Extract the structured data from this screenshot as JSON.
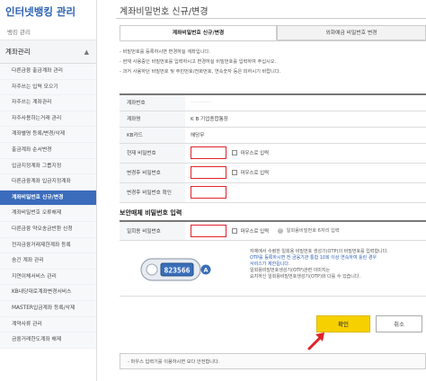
{
  "sidebar": {
    "title": "인터넷뱅킹 관리",
    "subtitle": "뱅킹 관리",
    "section": "계좌관리",
    "items": [
      "다른금융 출금계좌 관리",
      "자주쓰는 입력 모으기",
      "자주쓰는 계좌관리",
      "자주사용하는거래 관리",
      "계좌별명 등록/변경/삭제",
      "출금계좌 순서변경",
      "입금지정계좌 그룹지정",
      "다른금융계좌 입금지정계좌",
      "계좌비밀번호 신규/변경",
      "계좌비밀번호 오류해제",
      "다른금융 약오송금반환 신청",
      "전자금융거래제한계좌 등록",
      "숨긴 계좌 관리",
      "지연이체서비스 관리",
      "KB내당대로계좌변경서비스",
      "MASTER입금계좌 등록/삭제",
      "계약사류 관리",
      "금융거래한도계좌 해제"
    ],
    "active_index": 8
  },
  "page": {
    "title": "계좌비밀번호 신규/변경",
    "tabs": [
      "계좌비밀번호 신규/변경",
      "외화예금 비밀번호 변경"
    ],
    "notices": [
      "- 비밀번호를 등록하시면 변경하실 계좌입니다.",
      "- 현재 사용중인 비밀번호를 입력하시고 변경하실 비밀번호를 입력하여 주십시오.",
      "- 과거 사용하던 비밀번호 및 주민번호/전화번호, 연속숫자 등은 피하시기 바랍니다."
    ]
  },
  "form": {
    "rows": [
      {
        "label": "계좌번호",
        "value": "·············"
      },
      {
        "label": "계좌명",
        "value": "K B 기업종합통장"
      },
      {
        "label": "KB카드",
        "value": "해당무"
      },
      {
        "label": "현재 비밀번호",
        "value": ""
      },
      {
        "label": "변경후 비밀번호",
        "value": ""
      },
      {
        "label": "변경후 비밀번호 확인",
        "value": ""
      }
    ],
    "mouse_input_label": "마우스로 입력"
  },
  "security": {
    "title": "보안매체 비밀번호 입력",
    "otp_label": "일회용 비밀번호",
    "mouse_input_label": "마우스로 입력",
    "help_label": "일회용비밀번호 6자리 입력",
    "device_display": "823566",
    "device_marker": "A",
    "notes": [
      {
        "text": "자체에서 수령한 일회용 비밀번호 생성기(OTP)의 비밀번호를 입력합니다.",
        "style": "normal"
      },
      {
        "text": "OTP를 등록하시면 전 금융기관 통합 10회 이상 연속하여 틀린 경우",
        "style": "blue"
      },
      {
        "text": "서비스가 제한됩니다.",
        "style": "blue"
      },
      {
        "text": "일회용비밀번호생성기(OTP)관련 이미지는",
        "style": "normal"
      },
      {
        "text": "요지하신 일회용비밀번호생성기(OTP)와 다를 수 있습니다.",
        "style": "normal"
      }
    ]
  },
  "buttons": {
    "confirm": "확인",
    "cancel": "취소"
  },
  "footer_note": "- 마우스 입력기를 이용하시면 보다 안전합니다.",
  "colors": {
    "brand_blue": "#3b6cbc",
    "confirm_yellow": "#f7d000",
    "highlight_red": "#e0232b"
  }
}
